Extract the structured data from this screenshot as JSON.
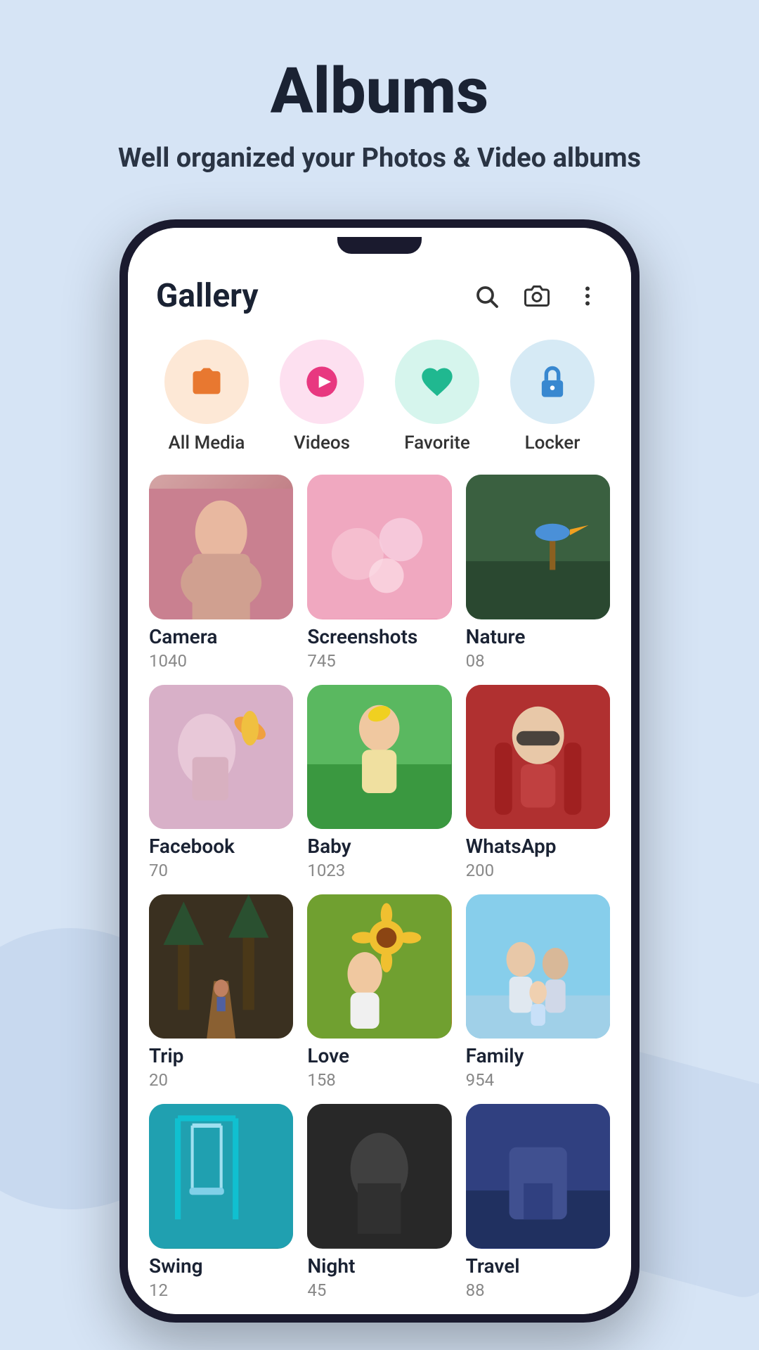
{
  "page": {
    "title": "Albums",
    "subtitle": "Well organized your Photos & Video albums",
    "background_color": "#d6e4f5"
  },
  "app": {
    "title": "Gallery",
    "header_icons": [
      "search",
      "camera",
      "more"
    ]
  },
  "categories": [
    {
      "id": "all-media",
      "label": "All Media",
      "icon": "folder",
      "bg": "all-media"
    },
    {
      "id": "videos",
      "label": "Videos",
      "icon": "play",
      "bg": "videos"
    },
    {
      "id": "favorite",
      "label": "Favorite",
      "icon": "heart",
      "bg": "favorite"
    },
    {
      "id": "locker",
      "label": "Locker",
      "icon": "lock",
      "bg": "locker"
    }
  ],
  "albums": [
    {
      "id": "camera",
      "name": "Camera",
      "count": "1040",
      "thumb": "camera"
    },
    {
      "id": "screenshots",
      "name": "Screenshots",
      "count": "745",
      "thumb": "screenshots"
    },
    {
      "id": "nature",
      "name": "Nature",
      "count": "08",
      "thumb": "nature"
    },
    {
      "id": "facebook",
      "name": "Facebook",
      "count": "70",
      "thumb": "facebook"
    },
    {
      "id": "baby",
      "name": "Baby",
      "count": "1023",
      "thumb": "baby"
    },
    {
      "id": "whatsapp",
      "name": "WhatsApp",
      "count": "200",
      "thumb": "whatsapp"
    },
    {
      "id": "trip",
      "name": "Trip",
      "count": "20",
      "thumb": "trip"
    },
    {
      "id": "love",
      "name": "Love",
      "count": "158",
      "thumb": "love"
    },
    {
      "id": "family",
      "name": "Family",
      "count": "954",
      "thumb": "family"
    },
    {
      "id": "extra1",
      "name": "Swing",
      "count": "12",
      "thumb": "extra1"
    },
    {
      "id": "extra2",
      "name": "Night",
      "count": "45",
      "thumb": "extra2"
    },
    {
      "id": "extra3",
      "name": "Travel",
      "count": "88",
      "thumb": "extra3"
    }
  ]
}
